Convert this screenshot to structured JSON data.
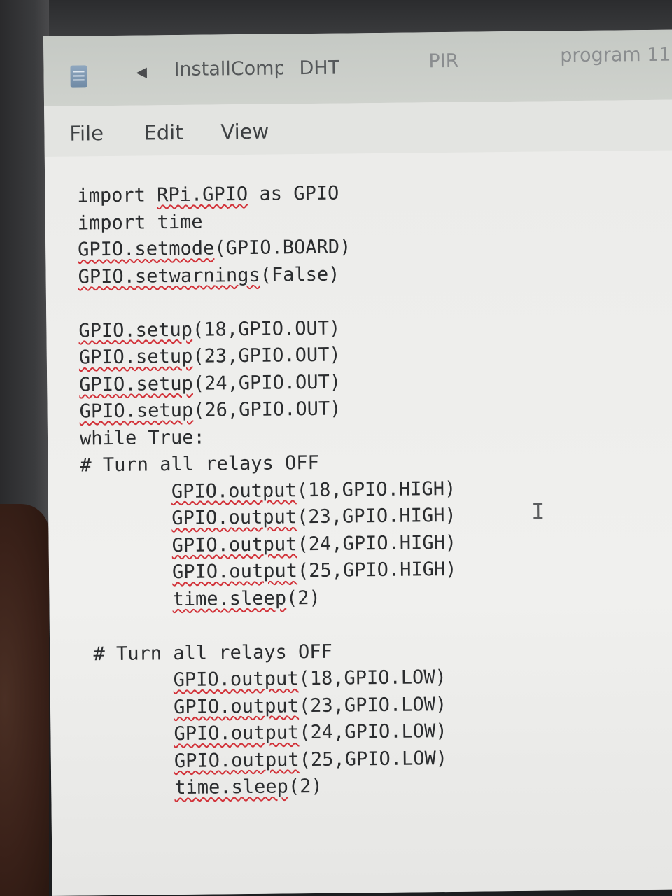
{
  "tabs": [
    {
      "label": "InstallCompä"
    },
    {
      "label": "DHT"
    },
    {
      "label": "PIR"
    },
    {
      "label": "program 11"
    }
  ],
  "menu": {
    "file": "File",
    "edit": "Edit",
    "view": "View"
  },
  "icons": {
    "app": "notepad-icon",
    "tab_scroll": "chevron-left-icon",
    "cursor": "text-cursor-icon"
  },
  "colors": {
    "spellcheck_underline": "#d2333a",
    "editor_background": "#ececea",
    "tabbar_background": "#c5c9c4"
  },
  "editor": {
    "lines": [
      "import RPi.GPIO as GPIO",
      "import time",
      "GPIO.setmode(GPIO.BOARD)",
      "GPIO.setwarnings(False)",
      "",
      "GPIO.setup(18,GPIO.OUT)",
      "GPIO.setup(23,GPIO.OUT)",
      "GPIO.setup(24,GPIO.OUT)",
      "GPIO.setup(26,GPIO.OUT)",
      "while True:",
      "# Turn all relays OFF",
      "        GPIO.output(18,GPIO.HIGH)",
      "        GPIO.output(23,GPIO.HIGH)",
      "        GPIO.output(24,GPIO.HIGH)",
      "        GPIO.output(25,GPIO.HIGH)",
      "        time.sleep(2)",
      "",
      " # Turn all relays OFF",
      "        GPIO.output(18,GPIO.LOW)",
      "        GPIO.output(23,GPIO.LOW)",
      "        GPIO.output(24,GPIO.LOW)",
      "        GPIO.output(25,GPIO.LOW)",
      "        time.sleep(2)"
    ],
    "misspelled": [
      "RPi.GPIO",
      "GPIO.setmode",
      "GPIO.setwarnings",
      "GPIO.setup",
      "GPIO.output",
      "time.sleep"
    ]
  }
}
